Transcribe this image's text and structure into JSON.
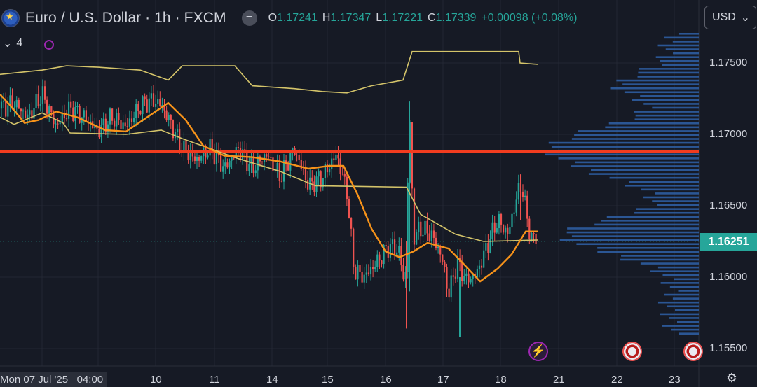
{
  "header": {
    "title": "Euro / U.S. Dollar · 1h · FXCM",
    "collapse_glyph": "−",
    "currency": "USD",
    "indicators_count": "4",
    "ohlc": {
      "o_key": "O",
      "o": "1.17241",
      "h_key": "H",
      "h": "1.17347",
      "l_key": "L",
      "l": "1.17221",
      "c_key": "C",
      "c": "1.17339",
      "change": "+0.00098 (+0.08%)"
    }
  },
  "events": {
    "bolt_glyph": "⚡"
  },
  "axis": {
    "price_ticks": [
      "1.17500",
      "1.17000",
      "1.16500",
      "1.16000",
      "1.15500"
    ],
    "last_price": "1.16251",
    "time_first": "Mon 07 Jul '25",
    "time_first_hour": "04:00",
    "time_ticks": [
      "10",
      "11",
      "14",
      "15",
      "16",
      "17",
      "18",
      "21",
      "22",
      "23"
    ],
    "settings_glyph": "⚙"
  },
  "chart_data": {
    "type": "candlestick",
    "symbol": "EURUSD",
    "interval": "1h",
    "ylim": [
      1.154,
      1.1775
    ],
    "x_range": [
      "2025-07-07",
      "2025-07-23"
    ],
    "grid": true,
    "colors": {
      "up": "#26a69a",
      "down": "#ef5350",
      "background": "#161a25",
      "ma_orange": "#f7931a",
      "upper_line": "#d4c46a",
      "lower_line": "#d4c46a",
      "level": "#f23c1f",
      "profile": "#2f62a8"
    },
    "horizontal_level": 1.1688,
    "last_price": 1.16251,
    "price_path": [
      [
        0,
        1.1718
      ],
      [
        20,
        1.1722
      ],
      [
        40,
        1.1712
      ],
      [
        60,
        1.1728
      ],
      [
        80,
        1.1706
      ],
      [
        100,
        1.1718
      ],
      [
        120,
        1.1712
      ],
      [
        140,
        1.1702
      ],
      [
        160,
        1.1712
      ],
      [
        180,
        1.1705
      ],
      [
        200,
        1.172
      ],
      [
        215,
        1.1724
      ],
      [
        230,
        1.1721
      ],
      [
        245,
        1.1706
      ],
      [
        260,
        1.169
      ],
      [
        280,
        1.1682
      ],
      [
        300,
        1.169
      ],
      [
        320,
        1.1676
      ],
      [
        340,
        1.169
      ],
      [
        360,
        1.1676
      ],
      [
        380,
        1.1686
      ],
      [
        400,
        1.167
      ],
      [
        420,
        1.169
      ],
      [
        440,
        1.1664
      ],
      [
        460,
        1.167
      ],
      [
        480,
        1.1686
      ],
      [
        495,
        1.166
      ],
      [
        505,
        1.1605
      ],
      [
        520,
        1.16
      ],
      [
        540,
        1.1612
      ],
      [
        555,
        1.1622
      ],
      [
        570,
        1.1618
      ],
      [
        578,
        1.159
      ],
      [
        584,
        1.1718
      ],
      [
        590,
        1.1628
      ],
      [
        600,
        1.1634
      ],
      [
        615,
        1.163
      ],
      [
        630,
        1.1615
      ],
      [
        640,
        1.1588
      ],
      [
        652,
        1.161
      ],
      [
        665,
        1.1598
      ],
      [
        680,
        1.1602
      ],
      [
        695,
        1.1622
      ],
      [
        710,
        1.164
      ],
      [
        725,
        1.163
      ],
      [
        738,
        1.1658
      ],
      [
        745,
        1.1665
      ],
      [
        752,
        1.164
      ],
      [
        760,
        1.1625
      ],
      [
        765,
        1.1628
      ]
    ],
    "ma_orange": [
      [
        0,
        1.1728
      ],
      [
        15,
        1.172
      ],
      [
        35,
        1.1708
      ],
      [
        55,
        1.171
      ],
      [
        80,
        1.1716
      ],
      [
        110,
        1.1712
      ],
      [
        150,
        1.1703
      ],
      [
        180,
        1.1702
      ],
      [
        210,
        1.1712
      ],
      [
        240,
        1.1722
      ],
      [
        265,
        1.171
      ],
      [
        290,
        1.1692
      ],
      [
        320,
        1.1685
      ],
      [
        360,
        1.1684
      ],
      [
        400,
        1.1681
      ],
      [
        440,
        1.1676
      ],
      [
        470,
        1.1678
      ],
      [
        490,
        1.1678
      ],
      [
        510,
        1.1658
      ],
      [
        530,
        1.1634
      ],
      [
        550,
        1.1618
      ],
      [
        570,
        1.1614
      ],
      [
        590,
        1.1618
      ],
      [
        610,
        1.1624
      ],
      [
        640,
        1.162
      ],
      [
        660,
        1.161
      ],
      [
        685,
        1.1597
      ],
      [
        710,
        1.1606
      ],
      [
        730,
        1.1616
      ],
      [
        750,
        1.1632
      ],
      [
        768,
        1.1632
      ]
    ],
    "upper_line": [
      [
        0,
        1.1742
      ],
      [
        60,
        1.1745
      ],
      [
        95,
        1.1748
      ],
      [
        140,
        1.1747
      ],
      [
        200,
        1.1745
      ],
      [
        240,
        1.1738
      ],
      [
        260,
        1.1748
      ],
      [
        335,
        1.1748
      ],
      [
        360,
        1.1734
      ],
      [
        420,
        1.1732
      ],
      [
        460,
        1.173
      ],
      [
        495,
        1.1729
      ],
      [
        530,
        1.1734
      ],
      [
        575,
        1.1738
      ],
      [
        588,
        1.1758
      ],
      [
        740,
        1.1758
      ],
      [
        742,
        1.175
      ],
      [
        767,
        1.1749
      ]
    ],
    "lower_line": [
      [
        0,
        1.1712
      ],
      [
        20,
        1.1707
      ],
      [
        60,
        1.1715
      ],
      [
        90,
        1.1708
      ],
      [
        100,
        1.1701
      ],
      [
        180,
        1.17
      ],
      [
        230,
        1.1703
      ],
      [
        260,
        1.1697
      ],
      [
        300,
        1.169
      ],
      [
        340,
        1.1683
      ],
      [
        400,
        1.1674
      ],
      [
        450,
        1.1664
      ],
      [
        580,
        1.1663
      ],
      [
        600,
        1.1644
      ],
      [
        650,
        1.163
      ],
      [
        690,
        1.1625
      ],
      [
        767,
        1.1626
      ]
    ],
    "volume_profile_range": [
      1.156,
      1.177
    ]
  }
}
